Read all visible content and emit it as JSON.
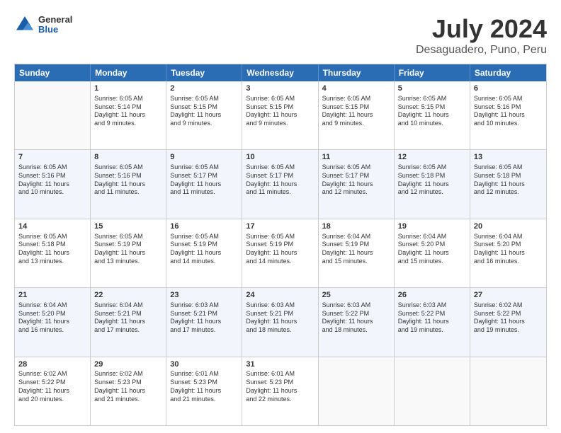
{
  "header": {
    "logo": {
      "line1": "General",
      "line2": "Blue"
    },
    "title": "July 2024",
    "location": "Desaguadero, Puno, Peru"
  },
  "calendar": {
    "days_of_week": [
      "Sunday",
      "Monday",
      "Tuesday",
      "Wednesday",
      "Thursday",
      "Friday",
      "Saturday"
    ],
    "rows": [
      [
        {
          "day": "",
          "info": ""
        },
        {
          "day": "1",
          "info": "Sunrise: 6:05 AM\nSunset: 5:14 PM\nDaylight: 11 hours\nand 9 minutes."
        },
        {
          "day": "2",
          "info": "Sunrise: 6:05 AM\nSunset: 5:15 PM\nDaylight: 11 hours\nand 9 minutes."
        },
        {
          "day": "3",
          "info": "Sunrise: 6:05 AM\nSunset: 5:15 PM\nDaylight: 11 hours\nand 9 minutes."
        },
        {
          "day": "4",
          "info": "Sunrise: 6:05 AM\nSunset: 5:15 PM\nDaylight: 11 hours\nand 9 minutes."
        },
        {
          "day": "5",
          "info": "Sunrise: 6:05 AM\nSunset: 5:15 PM\nDaylight: 11 hours\nand 10 minutes."
        },
        {
          "day": "6",
          "info": "Sunrise: 6:05 AM\nSunset: 5:16 PM\nDaylight: 11 hours\nand 10 minutes."
        }
      ],
      [
        {
          "day": "7",
          "info": "Sunrise: 6:05 AM\nSunset: 5:16 PM\nDaylight: 11 hours\nand 10 minutes."
        },
        {
          "day": "8",
          "info": "Sunrise: 6:05 AM\nSunset: 5:16 PM\nDaylight: 11 hours\nand 11 minutes."
        },
        {
          "day": "9",
          "info": "Sunrise: 6:05 AM\nSunset: 5:17 PM\nDaylight: 11 hours\nand 11 minutes."
        },
        {
          "day": "10",
          "info": "Sunrise: 6:05 AM\nSunset: 5:17 PM\nDaylight: 11 hours\nand 11 minutes."
        },
        {
          "day": "11",
          "info": "Sunrise: 6:05 AM\nSunset: 5:17 PM\nDaylight: 11 hours\nand 12 minutes."
        },
        {
          "day": "12",
          "info": "Sunrise: 6:05 AM\nSunset: 5:18 PM\nDaylight: 11 hours\nand 12 minutes."
        },
        {
          "day": "13",
          "info": "Sunrise: 6:05 AM\nSunset: 5:18 PM\nDaylight: 11 hours\nand 12 minutes."
        }
      ],
      [
        {
          "day": "14",
          "info": "Sunrise: 6:05 AM\nSunset: 5:18 PM\nDaylight: 11 hours\nand 13 minutes."
        },
        {
          "day": "15",
          "info": "Sunrise: 6:05 AM\nSunset: 5:19 PM\nDaylight: 11 hours\nand 13 minutes."
        },
        {
          "day": "16",
          "info": "Sunrise: 6:05 AM\nSunset: 5:19 PM\nDaylight: 11 hours\nand 14 minutes."
        },
        {
          "day": "17",
          "info": "Sunrise: 6:05 AM\nSunset: 5:19 PM\nDaylight: 11 hours\nand 14 minutes."
        },
        {
          "day": "18",
          "info": "Sunrise: 6:04 AM\nSunset: 5:19 PM\nDaylight: 11 hours\nand 15 minutes."
        },
        {
          "day": "19",
          "info": "Sunrise: 6:04 AM\nSunset: 5:20 PM\nDaylight: 11 hours\nand 15 minutes."
        },
        {
          "day": "20",
          "info": "Sunrise: 6:04 AM\nSunset: 5:20 PM\nDaylight: 11 hours\nand 16 minutes."
        }
      ],
      [
        {
          "day": "21",
          "info": "Sunrise: 6:04 AM\nSunset: 5:20 PM\nDaylight: 11 hours\nand 16 minutes."
        },
        {
          "day": "22",
          "info": "Sunrise: 6:04 AM\nSunset: 5:21 PM\nDaylight: 11 hours\nand 17 minutes."
        },
        {
          "day": "23",
          "info": "Sunrise: 6:03 AM\nSunset: 5:21 PM\nDaylight: 11 hours\nand 17 minutes."
        },
        {
          "day": "24",
          "info": "Sunrise: 6:03 AM\nSunset: 5:21 PM\nDaylight: 11 hours\nand 18 minutes."
        },
        {
          "day": "25",
          "info": "Sunrise: 6:03 AM\nSunset: 5:22 PM\nDaylight: 11 hours\nand 18 minutes."
        },
        {
          "day": "26",
          "info": "Sunrise: 6:03 AM\nSunset: 5:22 PM\nDaylight: 11 hours\nand 19 minutes."
        },
        {
          "day": "27",
          "info": "Sunrise: 6:02 AM\nSunset: 5:22 PM\nDaylight: 11 hours\nand 19 minutes."
        }
      ],
      [
        {
          "day": "28",
          "info": "Sunrise: 6:02 AM\nSunset: 5:22 PM\nDaylight: 11 hours\nand 20 minutes."
        },
        {
          "day": "29",
          "info": "Sunrise: 6:02 AM\nSunset: 5:23 PM\nDaylight: 11 hours\nand 21 minutes."
        },
        {
          "day": "30",
          "info": "Sunrise: 6:01 AM\nSunset: 5:23 PM\nDaylight: 11 hours\nand 21 minutes."
        },
        {
          "day": "31",
          "info": "Sunrise: 6:01 AM\nSunset: 5:23 PM\nDaylight: 11 hours\nand 22 minutes."
        },
        {
          "day": "",
          "info": ""
        },
        {
          "day": "",
          "info": ""
        },
        {
          "day": "",
          "info": ""
        }
      ]
    ]
  }
}
